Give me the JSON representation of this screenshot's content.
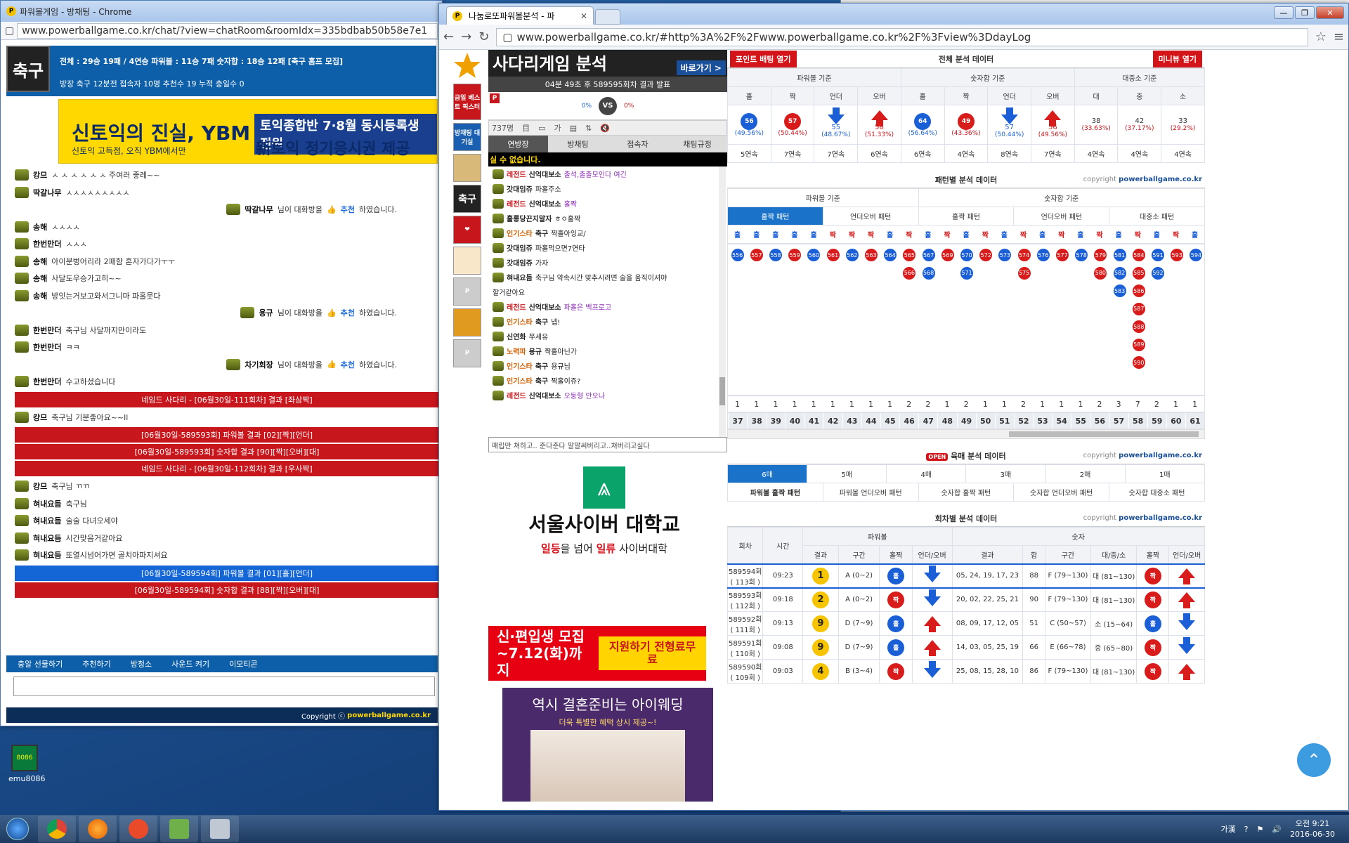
{
  "left_window": {
    "title": "파워볼게임 - 방채팅 - Chrome",
    "url": "www.powerballgame.co.kr/chat/?view=chatRoom&roomIdx=335bdbab50b58e7e1",
    "room_icon_text": "축구",
    "stats_line": "전체 : 29승 19패 / 4연승   파워볼 : 11승 7패   숫자합 : 18승 12패  [축구 홈프 모집]",
    "info_line": "방장 축구   12분전   접속자 10명   추천수 19   누적 충일수 0",
    "ad": {
      "t1": "신토익의 진실, YBM",
      "t2": "신토익 고득점, 오직 YBM에서만",
      "t3": "토익종합반 7·8월 동시등록생 전원",
      "t4": "新토익 정기응시권 제공"
    },
    "messages": [
      {
        "type": "chat",
        "name": "캉므",
        "text": "ㅅ ㅅ ㅅ ㅅ ㅅ ㅅ 주여러 좋레~~"
      },
      {
        "type": "chat",
        "name": "딱갈나무",
        "text": "ㅅㅅㅅㅅㅅㅅㅅㅅㅅ"
      },
      {
        "type": "rec",
        "name": "딱갈나무",
        "text": "님이 대화방을",
        "rec": "추천",
        "tail": "하였습니다."
      },
      {
        "type": "chat",
        "name": "송해",
        "text": "ㅅㅅㅅㅅ"
      },
      {
        "type": "chat",
        "name": "한번만더",
        "text": "ㅅㅅㅅ"
      },
      {
        "type": "chat",
        "name": "송해",
        "text": "아이분벙어리라 2패함 혼자가다가ㅜㅜ"
      },
      {
        "type": "chat",
        "name": "송해",
        "text": "사달도우승가고히~~"
      },
      {
        "type": "chat",
        "name": "송해",
        "text": "방잇는거보고와서그니마 파홀뭇다"
      },
      {
        "type": "rec",
        "name": "용규",
        "text": "님이 대화방을",
        "rec": "추천",
        "tail": "하였습니다."
      },
      {
        "type": "chat",
        "name": "한번만더",
        "text": "축구님 사달까지만이라도"
      },
      {
        "type": "chat",
        "name": "한번만더",
        "text": "ㅋㅋ"
      },
      {
        "type": "rec",
        "name": "차기회장",
        "text": "님이 대화방을",
        "rec": "추천",
        "tail": "하였습니다."
      },
      {
        "type": "chat",
        "name": "한번만더",
        "text": "수고하셨습니다"
      },
      {
        "type": "bar",
        "color": "red",
        "text": "네임드 사다리 - [06월30일-111회차] 결과 [좌삼짝]"
      },
      {
        "type": "chat",
        "name": "캉므",
        "text": "축구님  기분좋아요~~ll"
      },
      {
        "type": "bar",
        "color": "red",
        "text": "[06월30일-589593회] 파워볼 결과 [02][짝][언더]"
      },
      {
        "type": "bar",
        "color": "red",
        "text": "[06월30일-589593회] 숫자합 결과 [90][짝][오버][대]"
      },
      {
        "type": "bar",
        "color": "red",
        "text": "네임드 사다리 - [06월30일-112회차] 결과 [우사짝]"
      },
      {
        "type": "chat",
        "name": "캉므",
        "text": "축구님 ㄲㄲ"
      },
      {
        "type": "chat",
        "name": "혀내요듬",
        "text": "축구님"
      },
      {
        "type": "chat",
        "name": "혀내요듬",
        "text": "술술 다녀오세야"
      },
      {
        "type": "chat",
        "name": "혀내요듬",
        "text": "시간맞음거같아요"
      },
      {
        "type": "chat",
        "name": "혀내요듬",
        "text": "또열시넘어가면 골치아파지셔요"
      },
      {
        "type": "bar",
        "color": "blue",
        "text": "[06월30일-589594회] 파워볼 결과 [01][홀][언더]"
      },
      {
        "type": "bar",
        "color": "red",
        "text": "[06월30일-589594회] 숫자합 결과 [88][짝][오버][대]"
      }
    ],
    "toolbar": [
      "충알 선물하기",
      "추천하기",
      "방청소",
      "사운드 켜기",
      "이모티콘"
    ],
    "copyright": "Copyright ⓒ",
    "copyright_site": "powerballgame.co.kr"
  },
  "right_window": {
    "tab_title": "나눔로또파워볼분석 - 파",
    "url": "www.powerballgame.co.kr/#http%3A%2F%2Fwww.powerballgame.co.kr%2F%3Fview%3DdayLog",
    "side": [
      "금일 베스트 픽스터",
      "방채팅 대기실",
      "축구"
    ],
    "ladder_title": "사다리게임 분석",
    "ladder_go": "바로가기 >",
    "result_text": "04분 49초 후 589595회차 결과 발표",
    "vs_left": "0%",
    "vs_right": "0%",
    "vs": "VS",
    "user_count": "737명",
    "chat_tabs": [
      "연방장",
      "방채팅",
      "접속자",
      "채팅규정"
    ],
    "notice": "실 수 없습니다.",
    "chat": [
      {
        "lv": "레전드",
        "name": "신억대보소",
        "text": "출석,출출모인다 여긴"
      },
      {
        "lv": "",
        "name": "갓대임쥬",
        "text": "파홀주소"
      },
      {
        "lv": "레전드",
        "name": "신억대보소",
        "text": "홀짝"
      },
      {
        "lv": "",
        "name": "홀롱당끈지말자",
        "text": "ㅎㅇ홀짝"
      },
      {
        "lv": "인기스타",
        "name": "축구",
        "text": "짝홀아잉교/"
      },
      {
        "lv": "",
        "name": "갓대임쥬",
        "text": "파홀먹으면7연타"
      },
      {
        "lv": "",
        "name": "갓대임쥬",
        "text": "가자"
      },
      {
        "lv": "",
        "name": "혀내요듬",
        "text": "축구님 약속시간 맞추시려면 술을 움직이셔야"
      },
      {
        "lv": "",
        "name": "",
        "text": "할거같아요"
      },
      {
        "lv": "레전드",
        "name": "신억대보소",
        "text": "파홀은 백프로고"
      },
      {
        "lv": "인기스타",
        "name": "축구",
        "text": "넵!"
      },
      {
        "lv": "",
        "name": "신연화",
        "text": "쭈세유"
      },
      {
        "lv": "노력파",
        "name": "용규",
        "text": "짝홀아닌가"
      },
      {
        "lv": "인기스타",
        "name": "축구",
        "text": "용규님"
      },
      {
        "lv": "인기스타",
        "name": "축구",
        "text": "짝홀이쥬?"
      },
      {
        "lv": "레전드",
        "name": "신억대보소",
        "text": "오둥형 안오나"
      }
    ],
    "chat_input": "매립만 쳐하고.. 준다준다 말말씨버리고..쳐버리고싶다",
    "ad_univ": "서울사이버 대학교",
    "ad_univ_slogan_1": "일등",
    "ad_univ_slogan_2": "을 넘어 ",
    "ad_univ_slogan_3": "일류",
    "ad_univ_slogan_4": " 사이버대학",
    "ad_recruit": "신·편입생 모집 ~7.12(화)까지",
    "ad_recruit_btn": "지원하기 전형료무료",
    "ad_wedding": "역시 결혼준비는 아이웨딩",
    "ad_wedding_sub": "더욱 특별한 혜택 상시 제공~!",
    "btn_point": "포인트 배팅 열기",
    "btn_mini": "미니뷰 열기",
    "copyright": "copyright",
    "copyright_site": "powerballgame.co.kr",
    "total": {
      "title": "전체 분석 데이터",
      "groups": [
        "파워볼 기준",
        "숫자합 기준",
        "대중소 기준"
      ],
      "cols": [
        "홀",
        "짝",
        "언더",
        "오버",
        "홀",
        "짝",
        "언더",
        "오버",
        "대",
        "중",
        "소"
      ],
      "counts": [
        "56",
        "57",
        "55",
        "58",
        "64",
        "49",
        "57",
        "56",
        "38",
        "42",
        "33"
      ],
      "pcts": [
        "(49.56%)",
        "(50.44%)",
        "(48.67%)",
        "(51.33%)",
        "(56.64%)",
        "(43.36%)",
        "(50.44%)",
        "(49.56%)",
        "(33.63%)",
        "(37.17%)",
        "(29.2%)"
      ],
      "streaks": [
        "5연속",
        "7연속",
        "7연속",
        "6연속",
        "6연속",
        "4연속",
        "8연속",
        "7연속",
        "4연속",
        "4연속",
        "4연속"
      ]
    },
    "pattern": {
      "title": "패턴별 분석 데이터",
      "groups": [
        "파워볼 기준",
        "숫자합 기준"
      ],
      "tabs": [
        "홀짝 패턴",
        "언더오버 패턴",
        "홀짝 패턴",
        "언더오버 패턴",
        "대중소 패턴"
      ],
      "heads": [
        "홀",
        "홀",
        "홀",
        "홀",
        "홀",
        "짝",
        "짝",
        "짝",
        "홀",
        "짝",
        "홀",
        "짝",
        "홀",
        "짝",
        "홀",
        "짝",
        "홀",
        "짝",
        "홀",
        "짝",
        "홀",
        "짝",
        "홀",
        "짝",
        "홀"
      ],
      "counts": [
        "1",
        "1",
        "1",
        "1",
        "1",
        "1",
        "1",
        "1",
        "1",
        "2",
        "2",
        "1",
        "2",
        "1",
        "1",
        "2",
        "1",
        "1",
        "1",
        "2",
        "3",
        "7",
        "2",
        "1",
        "1"
      ],
      "nums": [
        "37",
        "38",
        "39",
        "40",
        "41",
        "42",
        "43",
        "44",
        "45",
        "46",
        "47",
        "48",
        "49",
        "50",
        "51",
        "52",
        "53",
        "54",
        "55",
        "56",
        "57",
        "58",
        "59",
        "60",
        "61"
      ],
      "balls": [
        {
          "c": 0,
          "r": 0,
          "v": "556",
          "k": "b"
        },
        {
          "c": 1,
          "r": 0,
          "v": "557",
          "k": "r"
        },
        {
          "c": 2,
          "r": 0,
          "v": "558",
          "k": "b"
        },
        {
          "c": 3,
          "r": 0,
          "v": "559",
          "k": "r"
        },
        {
          "c": 4,
          "r": 0,
          "v": "560",
          "k": "b"
        },
        {
          "c": 5,
          "r": 0,
          "v": "561",
          "k": "r"
        },
        {
          "c": 6,
          "r": 0,
          "v": "562",
          "k": "b"
        },
        {
          "c": 7,
          "r": 0,
          "v": "563",
          "k": "r"
        },
        {
          "c": 8,
          "r": 0,
          "v": "564",
          "k": "b"
        },
        {
          "c": 9,
          "r": 0,
          "v": "565",
          "k": "r"
        },
        {
          "c": 9,
          "r": 1,
          "v": "566",
          "k": "r"
        },
        {
          "c": 10,
          "r": 0,
          "v": "567",
          "k": "b"
        },
        {
          "c": 10,
          "r": 1,
          "v": "568",
          "k": "b"
        },
        {
          "c": 11,
          "r": 0,
          "v": "569",
          "k": "r"
        },
        {
          "c": 12,
          "r": 0,
          "v": "570",
          "k": "b"
        },
        {
          "c": 12,
          "r": 1,
          "v": "571",
          "k": "b"
        },
        {
          "c": 13,
          "r": 0,
          "v": "572",
          "k": "r"
        },
        {
          "c": 14,
          "r": 0,
          "v": "573",
          "k": "b"
        },
        {
          "c": 15,
          "r": 0,
          "v": "574",
          "k": "r"
        },
        {
          "c": 15,
          "r": 1,
          "v": "575",
          "k": "r"
        },
        {
          "c": 16,
          "r": 0,
          "v": "576",
          "k": "b"
        },
        {
          "c": 17,
          "r": 0,
          "v": "577",
          "k": "r"
        },
        {
          "c": 18,
          "r": 0,
          "v": "578",
          "k": "b"
        },
        {
          "c": 19,
          "r": 0,
          "v": "579",
          "k": "r"
        },
        {
          "c": 19,
          "r": 1,
          "v": "580",
          "k": "r"
        },
        {
          "c": 20,
          "r": 0,
          "v": "581",
          "k": "b"
        },
        {
          "c": 20,
          "r": 1,
          "v": "582",
          "k": "b"
        },
        {
          "c": 20,
          "r": 2,
          "v": "583",
          "k": "b"
        },
        {
          "c": 21,
          "r": 0,
          "v": "584",
          "k": "r"
        },
        {
          "c": 21,
          "r": 1,
          "v": "585",
          "k": "r"
        },
        {
          "c": 21,
          "r": 2,
          "v": "586",
          "k": "r"
        },
        {
          "c": 21,
          "r": 3,
          "v": "587",
          "k": "r"
        },
        {
          "c": 21,
          "r": 4,
          "v": "588",
          "k": "r"
        },
        {
          "c": 21,
          "r": 5,
          "v": "589",
          "k": "r"
        },
        {
          "c": 21,
          "r": 6,
          "v": "590",
          "k": "r"
        },
        {
          "c": 22,
          "r": 0,
          "v": "591",
          "k": "b"
        },
        {
          "c": 22,
          "r": 1,
          "v": "592",
          "k": "b"
        },
        {
          "c": 23,
          "r": 0,
          "v": "593",
          "k": "r"
        },
        {
          "c": 24,
          "r": 0,
          "v": "594",
          "k": "b"
        }
      ]
    },
    "six": {
      "open": "OPEN",
      "title": "육매 분석 데이터",
      "tabs": [
        "6매",
        "5매",
        "4매",
        "3매",
        "2매",
        "1매"
      ],
      "subtabs": [
        "파워볼 홀짝 패턴",
        "파워볼 언더오버 패턴",
        "숫자합 홀짝 패턴",
        "숫자합 언더오버 패턴",
        "숫자합 대중소 패턴"
      ]
    },
    "rounds": {
      "title": "회차별 분석 데이터",
      "h_round": "회차",
      "h_time": "시간",
      "h_pb": "파워볼",
      "h_num": "숫자",
      "sub": [
        "결과",
        "구간",
        "홀짝",
        "언더/오버",
        "결과",
        "합",
        "구간",
        "대/중/소",
        "홀짝",
        "언더/오버"
      ],
      "rows": [
        {
          "round": "589594회",
          "sub": "( 113회 )",
          "time": "09:23",
          "pb": "1",
          "zone": "A (0~2)",
          "oe": "홀",
          "uo": "down",
          "nums": "05, 24, 19, 17, 23",
          "sum": "88",
          "nzone": "F (79~130)",
          "size": "대 (81~130)",
          "noe": "짝",
          "nuo": "up"
        },
        {
          "round": "589593회",
          "sub": "( 112회 )",
          "time": "09:18",
          "pb": "2",
          "zone": "A (0~2)",
          "oe": "짝",
          "uo": "down",
          "nums": "20, 02, 22, 25, 21",
          "sum": "90",
          "nzone": "F (79~130)",
          "size": "대 (81~130)",
          "noe": "짝",
          "nuo": "up"
        },
        {
          "round": "589592회",
          "sub": "( 111회 )",
          "time": "09:13",
          "pb": "9",
          "zone": "D (7~9)",
          "oe": "홀",
          "uo": "up",
          "nums": "08, 09, 17, 12, 05",
          "sum": "51",
          "nzone": "C (50~57)",
          "size": "소 (15~64)",
          "noe": "홀",
          "nuo": "down"
        },
        {
          "round": "589591회",
          "sub": "( 110회 )",
          "time": "09:08",
          "pb": "9",
          "zone": "D (7~9)",
          "oe": "홀",
          "uo": "up",
          "nums": "14, 03, 05, 25, 19",
          "sum": "66",
          "nzone": "E (66~78)",
          "size": "중 (65~80)",
          "noe": "짝",
          "nuo": "down"
        },
        {
          "round": "589590회",
          "sub": "( 109회 )",
          "time": "09:03",
          "pb": "4",
          "zone": "B (3~4)",
          "oe": "짝",
          "uo": "down",
          "nums": "25, 08, 15, 28, 10",
          "sum": "86",
          "nzone": "F (79~130)",
          "size": "대 (81~130)",
          "noe": "짝",
          "nuo": "up"
        }
      ]
    }
  },
  "taskbar": {
    "ime": "가漢",
    "time": "오전 9:21",
    "date": "2016-06-30"
  },
  "desktop_icon": {
    "label": "emu8086",
    "badge": "8086"
  }
}
